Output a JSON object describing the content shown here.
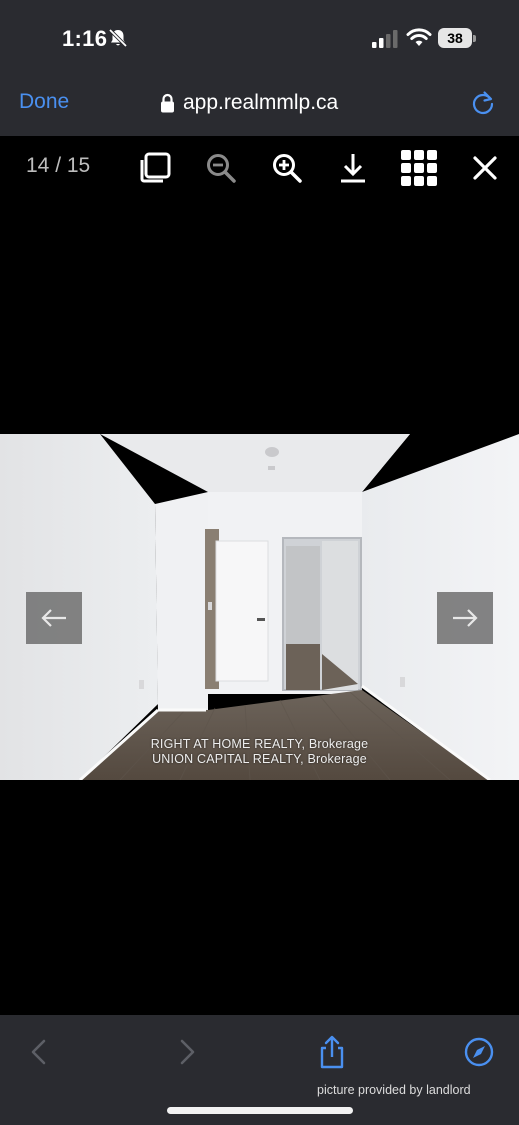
{
  "status_bar": {
    "time": "1:16",
    "battery": "38",
    "icons": [
      "bell-slash-icon",
      "cellular-signal-icon",
      "wifi-icon",
      "battery-icon"
    ]
  },
  "browser": {
    "done_label": "Done",
    "url": "app.realmmlp.ca",
    "icons": [
      "lock-icon",
      "reload-icon"
    ],
    "accent_color": "#4a90f0"
  },
  "viewer": {
    "counter": "14 / 15",
    "toolbar_icons": [
      "copy-icon",
      "zoom-out-icon",
      "zoom-in-icon",
      "download-icon",
      "grid-icon",
      "close-icon"
    ],
    "image": {
      "watermark_line1": "RIGHT AT HOME REALTY, Brokerage",
      "watermark_line2": "UNION CAPITAL REALTY, Brokerage"
    },
    "nav_icons": [
      "arrow-left-icon",
      "arrow-right-icon"
    ]
  },
  "bottom_bar": {
    "icons": [
      "chevron-left-icon",
      "chevron-right-icon",
      "share-icon",
      "compass-icon"
    ],
    "caption": "picture provided by landlord"
  }
}
